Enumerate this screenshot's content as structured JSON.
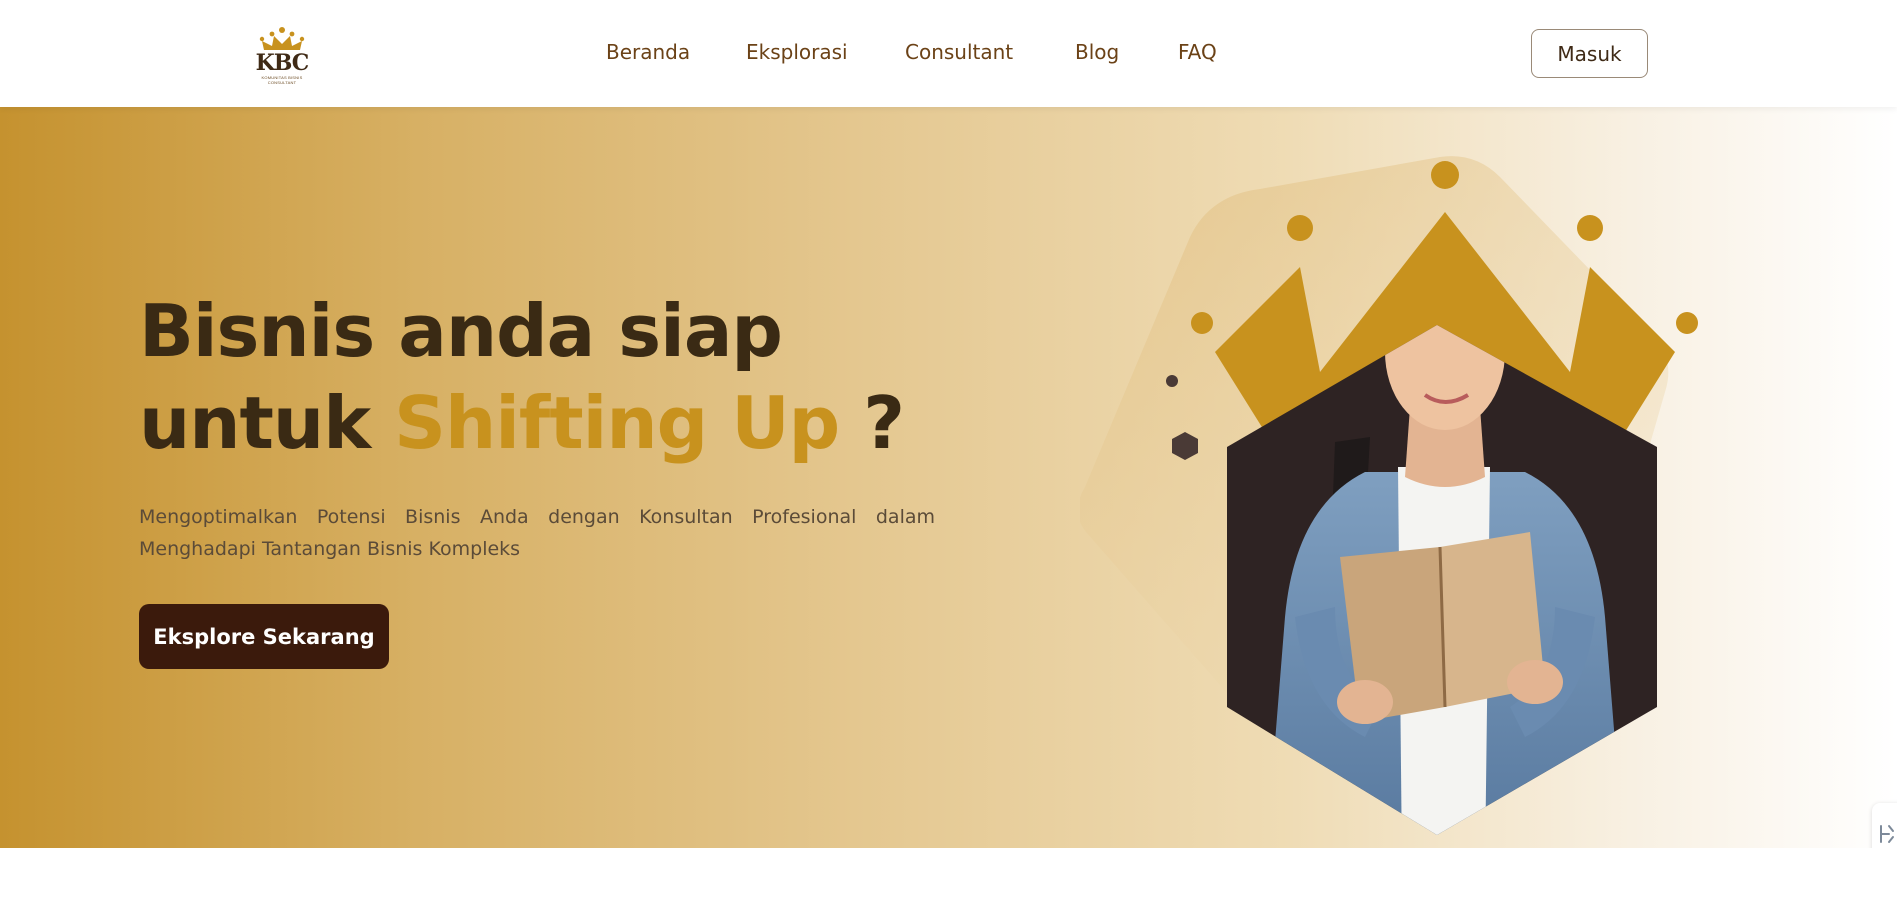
{
  "header": {
    "logo": {
      "text": "KBC",
      "subtitle": "KOMUNITAS BISNIS CONSULTANT",
      "icon": "crown-icon"
    },
    "nav": [
      "Beranda",
      "Eksplorasi",
      "Consultant",
      "Blog",
      "FAQ"
    ],
    "login_label": "Masuk"
  },
  "hero": {
    "title_line1": "Bisnis anda siap",
    "title_line2_prefix": "untuk ",
    "title_accent": "Shifting Up",
    "title_suffix": " ?",
    "description": "Mengoptimalkan Potensi Bisnis Anda dengan Konsultan Profesional dalam Menghadapi Tantangan Bisnis Kompleks",
    "cta_label": "Eksplore Sekarang",
    "illustration": "crown-hexagon-student-reading"
  },
  "side_tab": {
    "icon": "translate-icon"
  },
  "colors": {
    "brand_dark": "#3b1a0c",
    "brand_gold": "#c8921e",
    "nav_text": "#6b4217",
    "hex_dark": "#2e2323"
  }
}
